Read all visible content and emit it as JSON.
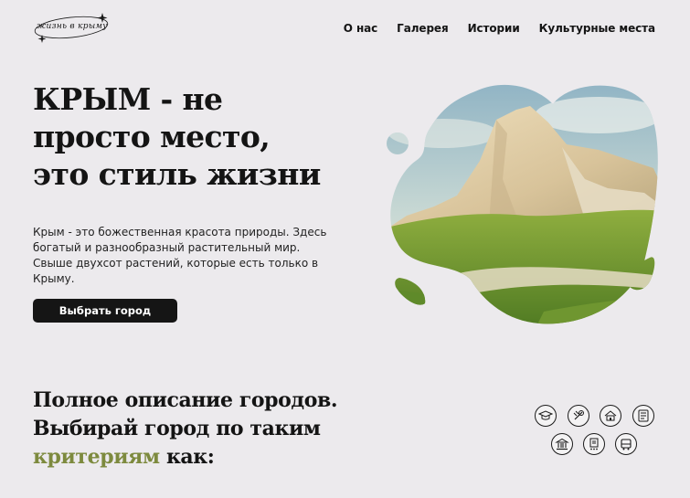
{
  "logo": {
    "text": "жизнь в крыму",
    "icon": "sparkle-icon"
  },
  "nav": [
    {
      "label": "О нас"
    },
    {
      "label": "Галерея"
    },
    {
      "label": "Истории"
    },
    {
      "label": "Культурные места"
    }
  ],
  "hero": {
    "title_line1": "КРЫМ - не",
    "title_line2": "просто место,",
    "title_line3": "это стиль жизни",
    "description": "Крым - это божественная красота природы. Здесь богатый и разнообразный растительный мир. Свыше двухсот растений, которые есть только в Крыму.",
    "button_label": "Выбрать город"
  },
  "criteria": {
    "line1": "Полное описание городов.",
    "line2": "Выбирай город по таким",
    "accent": "критериям",
    "line3_rest": " как:",
    "icons": [
      "education-icon",
      "food-icon",
      "housing-icon",
      "prices-icon",
      "museum-icon",
      "document-icon",
      "bus-icon"
    ]
  },
  "colors": {
    "accent": "#7d8a3e",
    "background": "#eceaed",
    "button": "#151515"
  }
}
